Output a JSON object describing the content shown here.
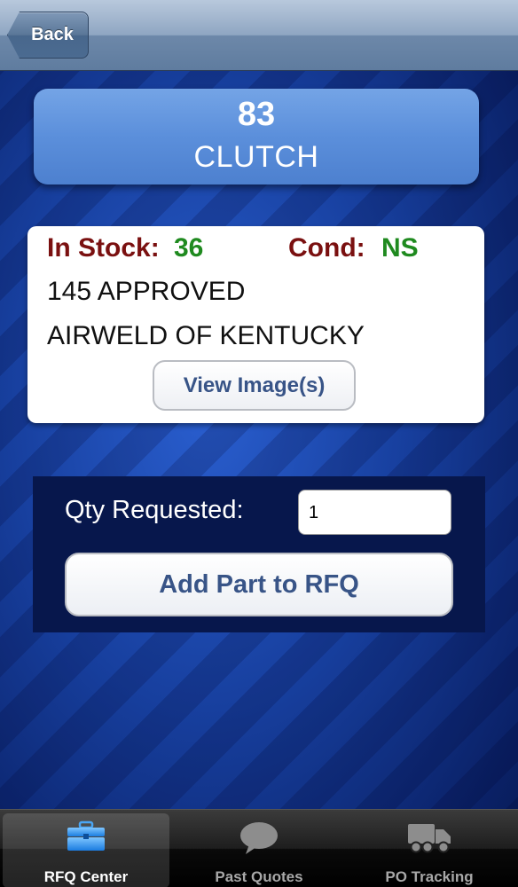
{
  "nav": {
    "back_label": "Back"
  },
  "part": {
    "number": "83",
    "name": "CLUTCH"
  },
  "info": {
    "stock_label": "In Stock:",
    "stock_value": "36",
    "cond_label": "Cond:",
    "cond_value": "NS",
    "line1": "145 APPROVED",
    "line2": "AIRWELD OF KENTUCKY",
    "view_image_label": "View Image(s)"
  },
  "qty": {
    "label": "Qty Requested:",
    "value": "1",
    "add_label": "Add Part to RFQ"
  },
  "tabs": [
    {
      "label": "RFQ Center",
      "icon": "toolbox-icon",
      "active": true
    },
    {
      "label": "Past Quotes",
      "icon": "speech-bubble-icon",
      "active": false
    },
    {
      "label": "PO Tracking",
      "icon": "truck-icon",
      "active": false
    }
  ],
  "colors": {
    "accent_blue": "#5b8fdb",
    "stock_label": "#7a1010",
    "stock_value": "#1f8a1f",
    "button_text": "#385487"
  }
}
